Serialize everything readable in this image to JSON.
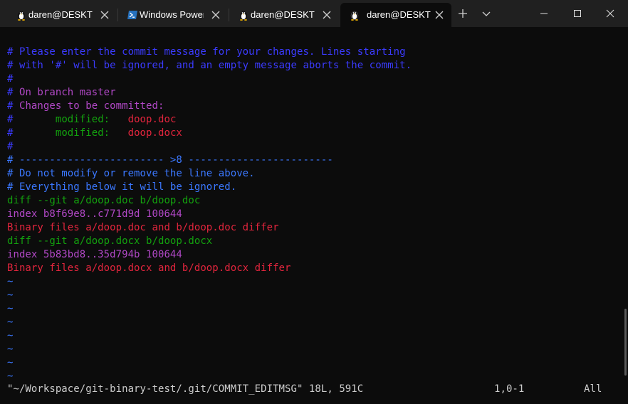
{
  "tabs": [
    {
      "label": "daren@DESKTOP",
      "icon": "linux-penguin-icon",
      "active": false
    },
    {
      "label": "Windows PowerShell",
      "icon": "powershell-icon",
      "active": false
    },
    {
      "label": "daren@DESKTOP",
      "icon": "linux-penguin-icon",
      "active": false
    },
    {
      "label": "daren@DESKTOP",
      "icon": "linux-penguin-icon",
      "active": true
    }
  ],
  "toolbar": {
    "new_tab_icon": "plus-icon",
    "dropdown_icon": "chevron-down-icon"
  },
  "window_controls": {
    "minimize": "minimize-icon",
    "maximize": "maximize-icon",
    "close": "close-icon"
  },
  "terminal": {
    "lines": [
      {
        "text": "# Please enter the commit message for your changes. Lines starting",
        "color": "blue"
      },
      {
        "text": "# with '#' will be ignored, and an empty message aborts the commit.",
        "color": "blue"
      },
      {
        "text": "#",
        "color": "blue"
      },
      {
        "segments": [
          {
            "text": "# ",
            "color": "blue"
          },
          {
            "text": "On branch master",
            "color": "purple"
          }
        ]
      },
      {
        "segments": [
          {
            "text": "# ",
            "color": "blue"
          },
          {
            "text": "Changes to be committed:",
            "color": "purple"
          }
        ]
      },
      {
        "segments": [
          {
            "text": "#       ",
            "color": "blue"
          },
          {
            "text": "modified:   ",
            "color": "green"
          },
          {
            "text": "doop.doc",
            "color": "red"
          }
        ]
      },
      {
        "segments": [
          {
            "text": "#       ",
            "color": "blue"
          },
          {
            "text": "modified:   ",
            "color": "green"
          },
          {
            "text": "doop.docx",
            "color": "red"
          }
        ]
      },
      {
        "text": "#",
        "color": "blue"
      },
      {
        "text": "# ------------------------ >8 ------------------------",
        "color": "blue2"
      },
      {
        "text": "# Do not modify or remove the line above.",
        "color": "blue2"
      },
      {
        "text": "# Everything below it will be ignored.",
        "color": "blue2"
      },
      {
        "text": "diff --git a/doop.doc b/doop.doc",
        "color": "green"
      },
      {
        "text": "index b8f69e8..c771d9d 100644",
        "color": "purple"
      },
      {
        "text": "Binary files a/doop.doc and b/doop.doc differ",
        "color": "red"
      },
      {
        "text": "diff --git a/doop.docx b/doop.docx",
        "color": "green"
      },
      {
        "text": "index 5b83bd8..35d794b 100644",
        "color": "purple"
      },
      {
        "text": "Binary files a/doop.docx and b/doop.docx differ",
        "color": "red"
      },
      {
        "text": "~",
        "color": "blue2"
      },
      {
        "text": "~",
        "color": "blue2"
      },
      {
        "text": "~",
        "color": "blue2"
      },
      {
        "text": "~",
        "color": "blue2"
      },
      {
        "text": "~",
        "color": "blue2"
      },
      {
        "text": "~",
        "color": "blue2"
      },
      {
        "text": "~",
        "color": "blue2"
      },
      {
        "text": "~",
        "color": "blue2"
      }
    ],
    "status": {
      "file": "\"~/Workspace/git-binary-test/.git/COMMIT_EDITMSG\" 18L, 591C",
      "position": "1,0-1",
      "scroll": "All"
    }
  },
  "colors": {
    "background": "#0c0c0c",
    "titlebar": "#202020",
    "blue": "#3b3bff",
    "purple": "#b148c6",
    "green": "#13a10e",
    "red": "#e2253d"
  }
}
